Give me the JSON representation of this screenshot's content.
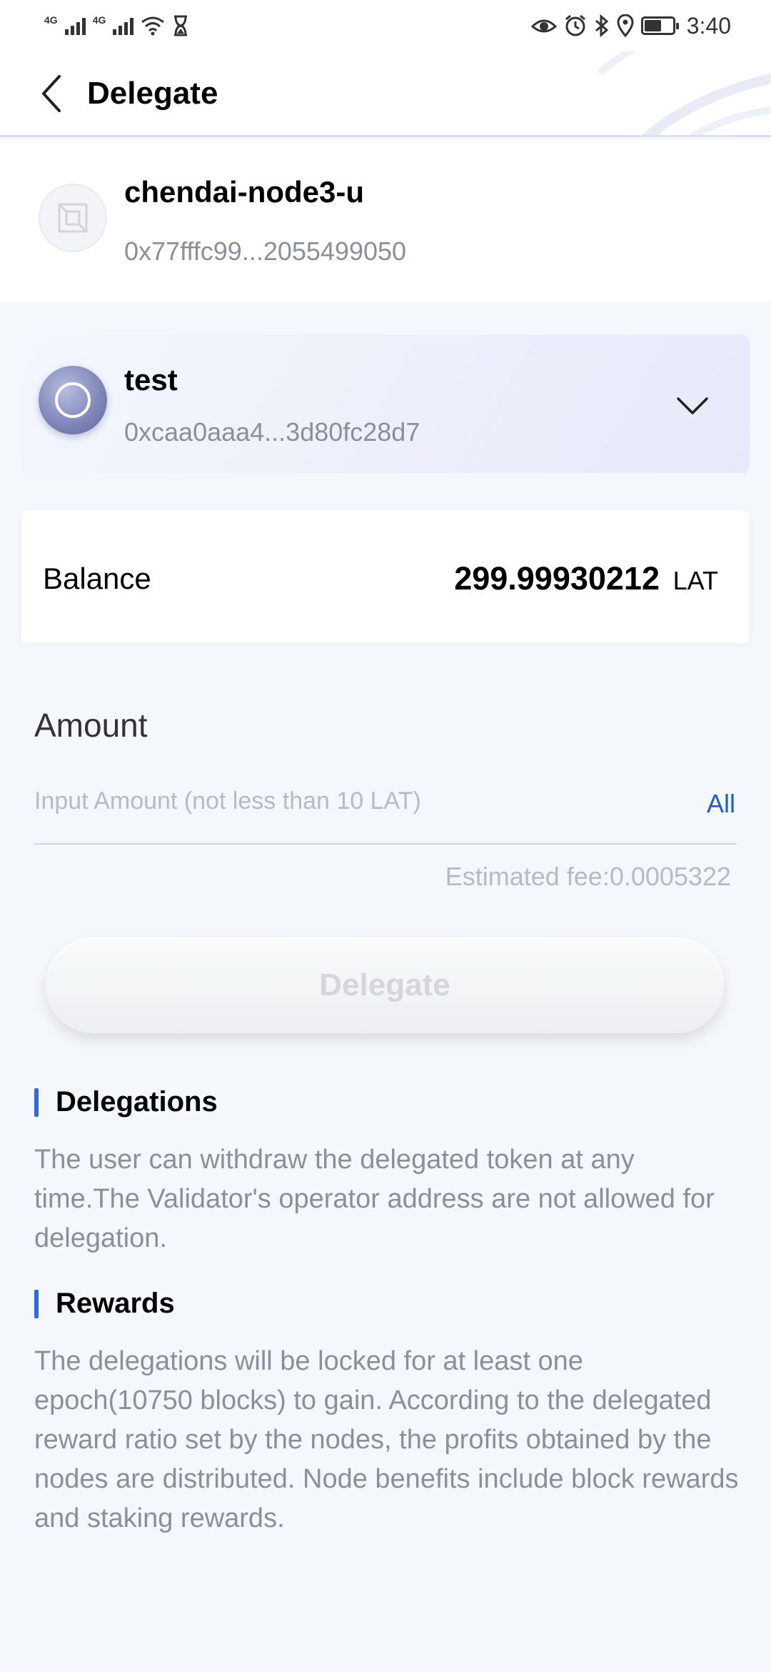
{
  "status_bar": {
    "network_1": "4G",
    "network_2": "4G",
    "time": "3:40"
  },
  "header": {
    "title": "Delegate"
  },
  "node": {
    "name": "chendai-node3-u",
    "address": "0x77fffc99...2055499050"
  },
  "wallet": {
    "name": "test",
    "address": "0xcaa0aaa4...3d80fc28d7"
  },
  "balance": {
    "label": "Balance",
    "value": "299.99930212",
    "unit": "LAT"
  },
  "amount": {
    "title": "Amount",
    "placeholder": "Input Amount (not less than 10 LAT)",
    "value": "",
    "all_label": "All",
    "fee": "Estimated fee:0.0005322"
  },
  "delegate_button": {
    "label": "Delegate"
  },
  "sections": {
    "delegations": {
      "title": "Delegations",
      "body": "The user can withdraw the delegated token at any time.The Validator's operator address are not allowed for delegation."
    },
    "rewards": {
      "title": "Rewards",
      "body": "The delegations will be locked for at least one epoch(10750 blocks) to gain. According to the delegated reward ratio set by the nodes, the profits obtained by the nodes are distributed. Node benefits include block rewards and staking rewards."
    }
  },
  "colors": {
    "accent": "#2f6be0",
    "link": "#1e5bd8",
    "muted_text": "#8a8f99",
    "placeholder": "#b6bac4",
    "background": "#f4f7fc"
  }
}
